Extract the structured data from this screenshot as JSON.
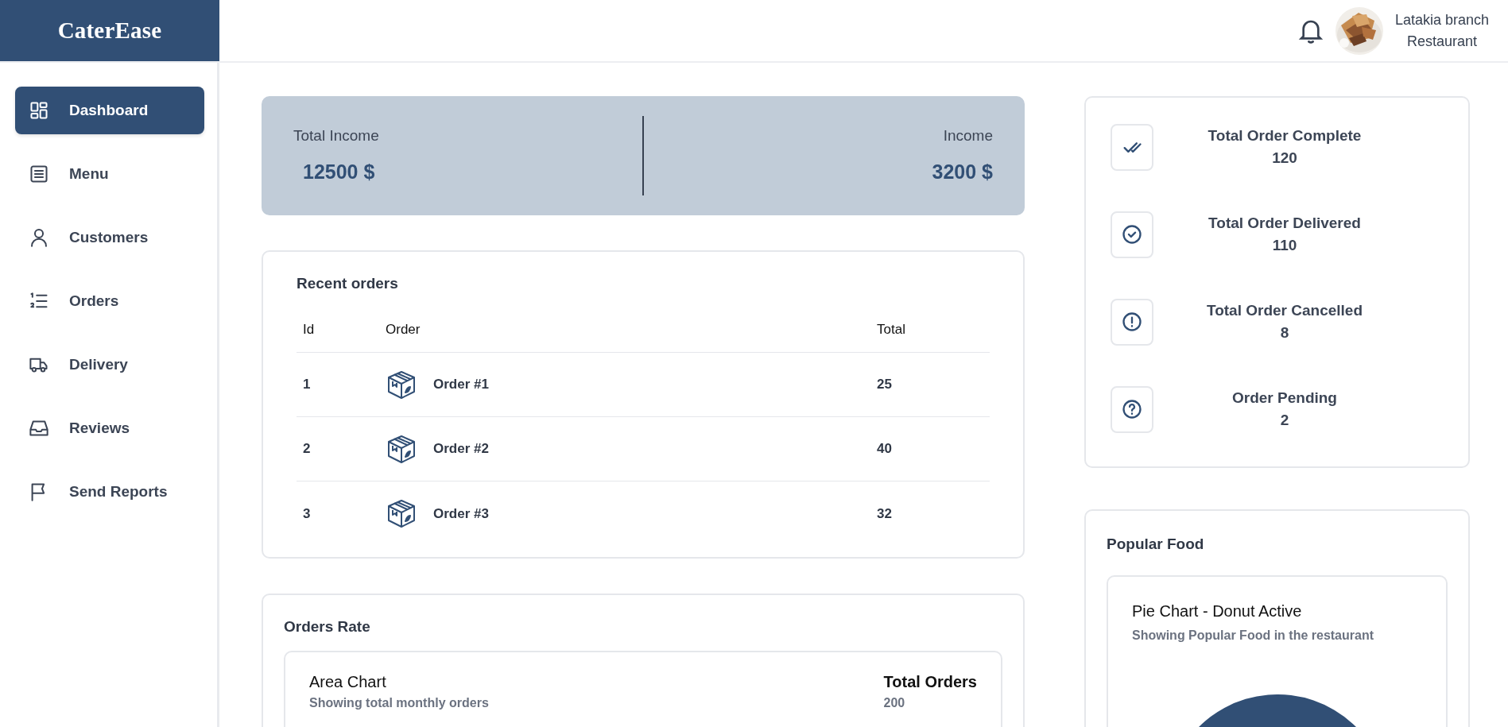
{
  "brand": {
    "name": "CaterEase"
  },
  "sidebar": {
    "items": [
      {
        "label": "Dashboard",
        "kind": "dashboard",
        "selected": true
      },
      {
        "label": "Menu",
        "kind": "menu",
        "selected": false
      },
      {
        "label": "Customers",
        "kind": "customers",
        "selected": false
      },
      {
        "label": "Orders",
        "kind": "orders",
        "selected": false
      },
      {
        "label": "Delivery",
        "kind": "delivery",
        "selected": false
      },
      {
        "label": "Reviews",
        "kind": "reviews",
        "selected": false
      },
      {
        "label": "Send Reports",
        "kind": "reports",
        "selected": false
      }
    ]
  },
  "header": {
    "account": {
      "name": "Latakia branch",
      "role": "Restaurant"
    }
  },
  "income": {
    "left": {
      "label": "Total Income",
      "value": "12500 $"
    },
    "right": {
      "label": "Income",
      "value": "3200 $"
    }
  },
  "recent_orders": {
    "title": "Recent orders",
    "columns": [
      "Id",
      "Order",
      "Total"
    ],
    "rows": [
      {
        "id": "1",
        "order": "Order #1",
        "total": "25"
      },
      {
        "id": "2",
        "order": "Order #2",
        "total": "40"
      },
      {
        "id": "3",
        "order": "Order #3",
        "total": "32"
      }
    ]
  },
  "orders_rate": {
    "title": "Orders Rate",
    "chart_title": "Area Chart",
    "chart_subtitle": "Showing total monthly orders",
    "total_label": "Total Orders",
    "total_value": "200"
  },
  "order_stats": [
    {
      "kind": "complete",
      "label": "Total Order Complete",
      "value": "120"
    },
    {
      "kind": "delivered",
      "label": "Total Order Delivered",
      "value": "110"
    },
    {
      "kind": "cancelled",
      "label": "Total Order Cancelled",
      "value": "8"
    },
    {
      "kind": "pending",
      "label": "Order Pending",
      "value": "2"
    }
  ],
  "popular_food": {
    "title": "Popular Food",
    "chart_title": "Pie Chart - Donut Active",
    "chart_subtitle": "Showing Popular Food in the restaurant"
  }
}
